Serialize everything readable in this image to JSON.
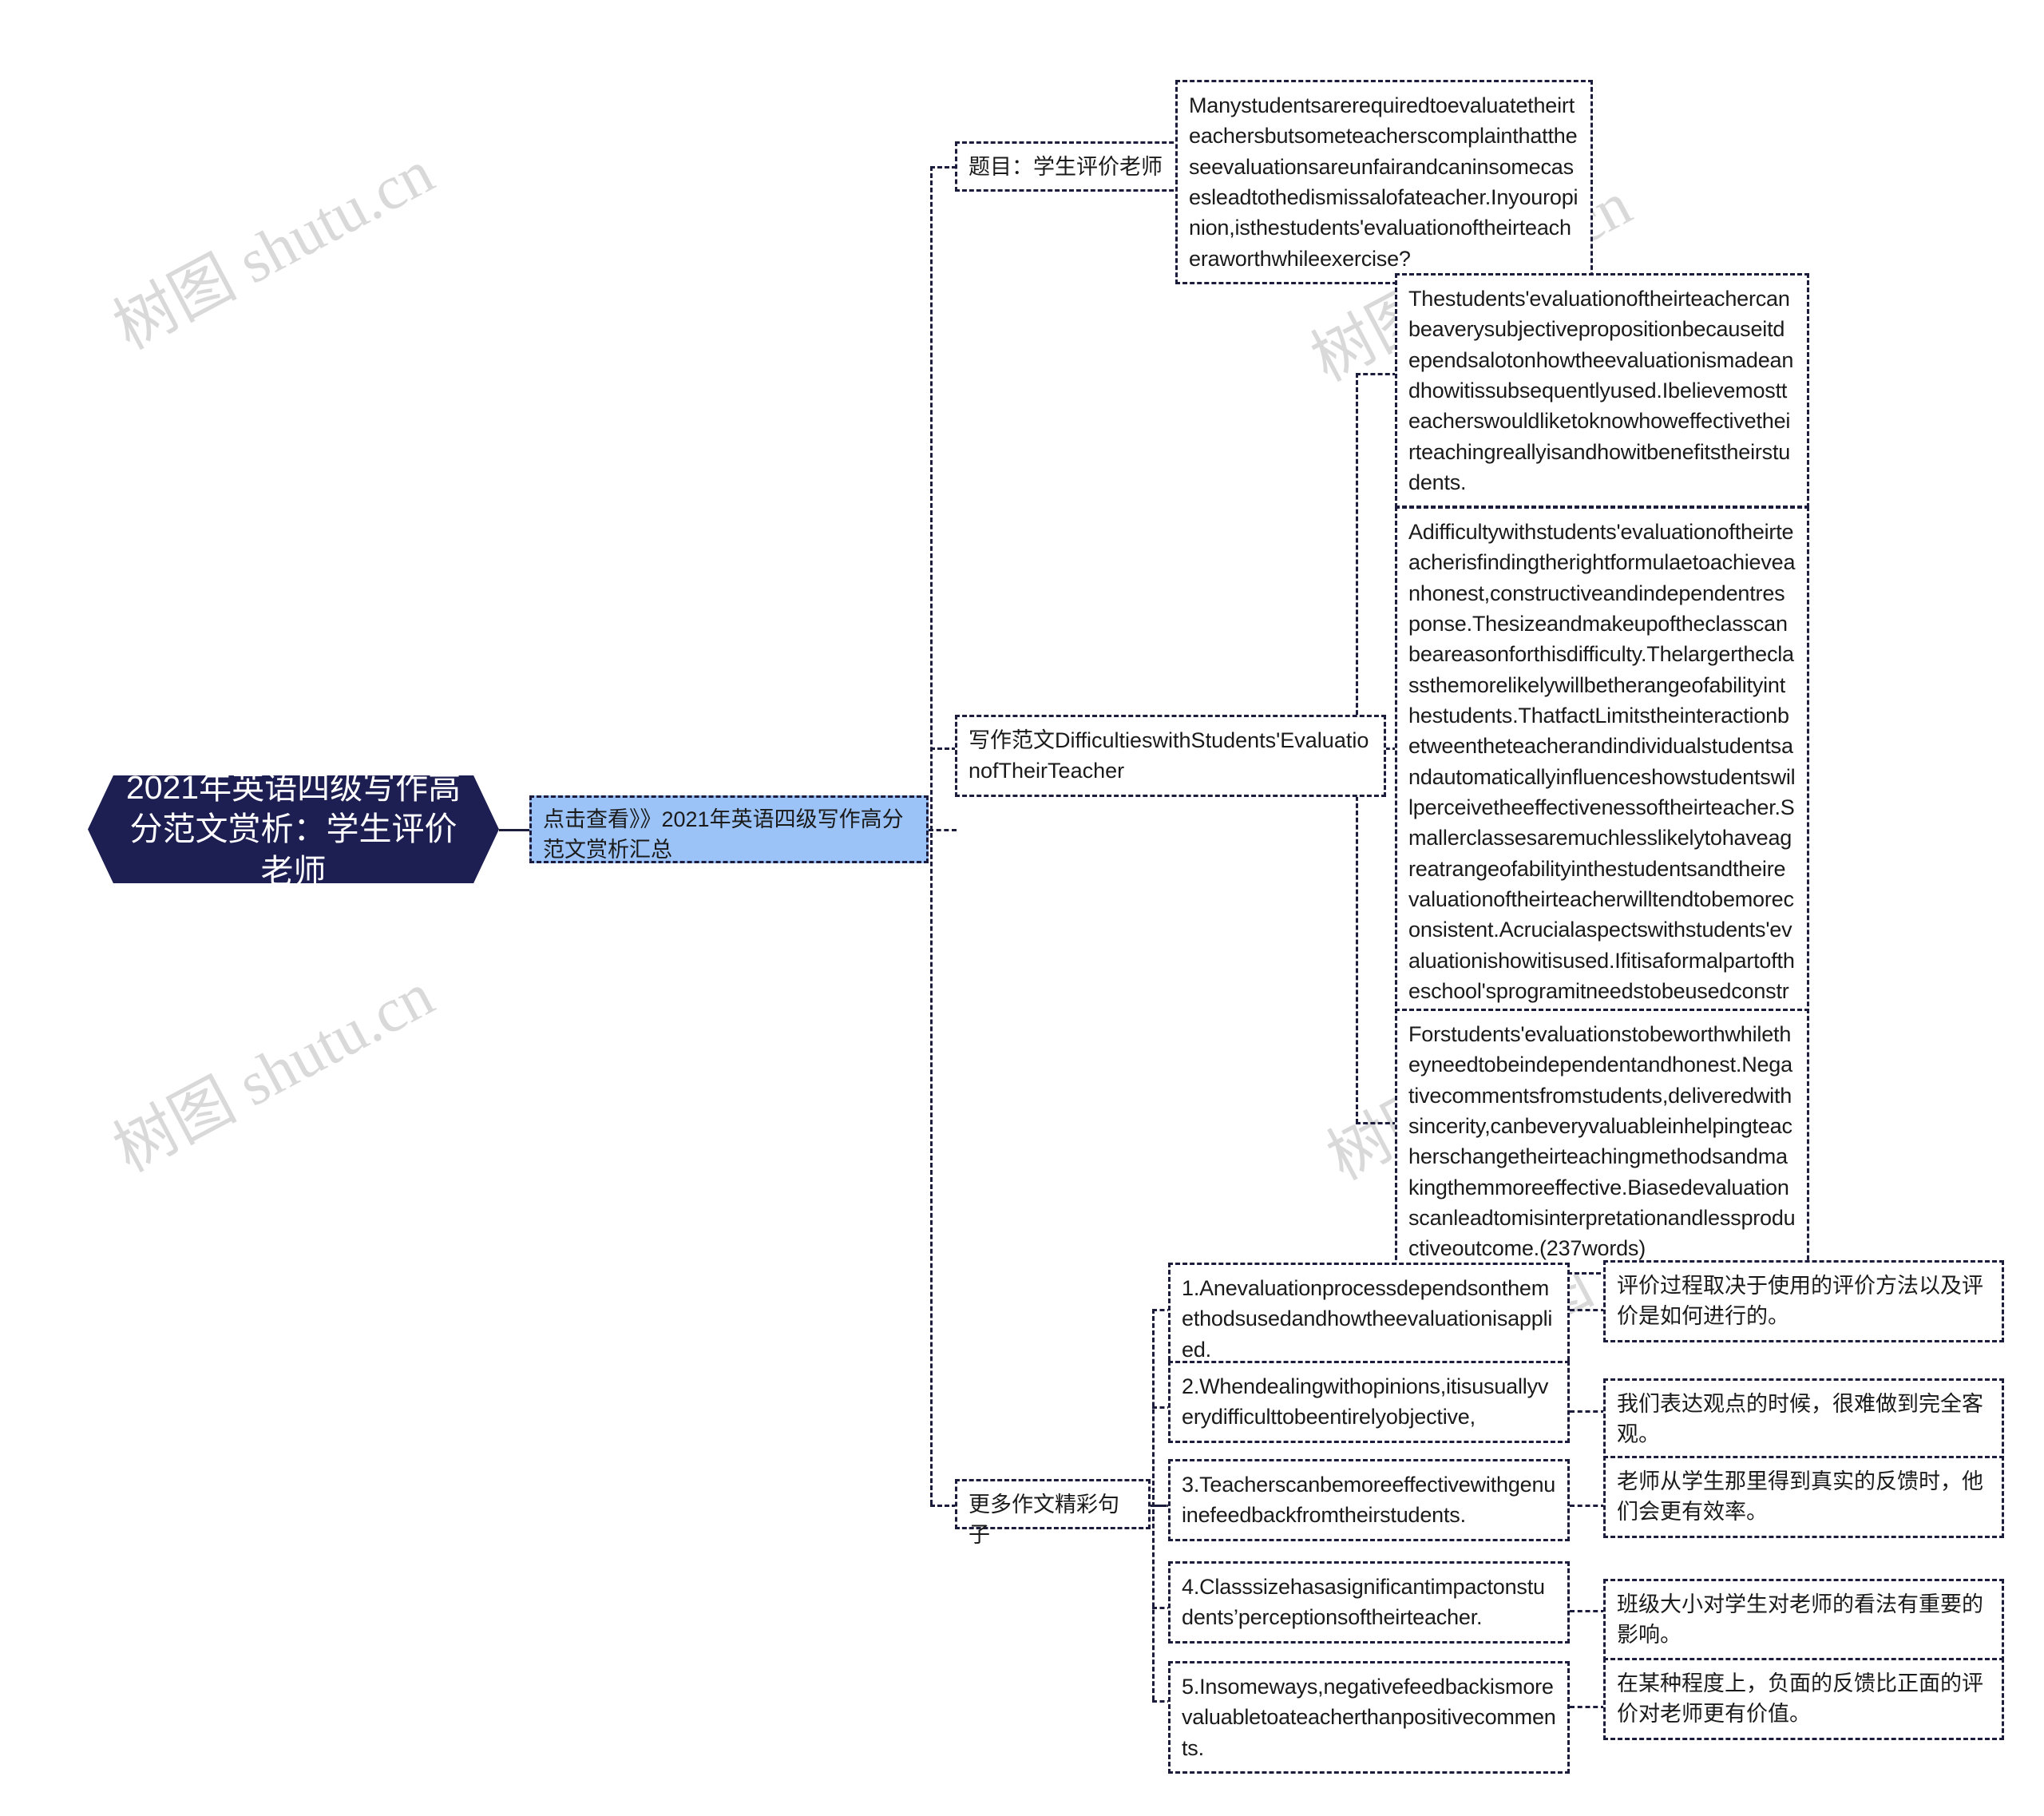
{
  "watermarks": [
    "树图 shutu.cn",
    "树图 shutu.cn",
    "树图 shutu.cn",
    "树图 shutu.cn",
    "树图 shutu.cn"
  ],
  "colors": {
    "root_bg": "#1d1e52",
    "root_text": "#ffffff",
    "link_bg": "#9cc3f7",
    "border": "#1c1c3c",
    "node_bg": "#ffffff",
    "text": "#1a1a1a",
    "watermark": "#d9d9d9"
  },
  "root": {
    "title": "2021年英语四级写作高分范文赏析：学生评价老师"
  },
  "link_node": {
    "label": "点击查看》》2021年英语四级写作高分范文赏析汇总"
  },
  "branches": {
    "topic": {
      "label": "题目：学生评价老师",
      "content": "Manystudentsarerequiredtoevaluatetheirteachersbutsometeacherscomplainthattheseevaluationsareunfairandcaninsomecasesleadtothedismissalofateacher.Inyouropinion,isthestudents'evaluationoftheirteacheraworthwhileexercise?"
    },
    "essay": {
      "label": "写作范文DifficultieswithStudents'EvaluationofTheirTeacher",
      "paragraphs": [
        "Thestudents'evaluationoftheirteachercanbeaverysubjectivepropositionbecauseitdependsalotonhowtheevaluationismadeandhowitissubsequentlyused.Ibelievemostteacherswouldliketoknowhoweffectivetheirteachingreallyisandhowitbenefitstheirstudents.",
        "Adifficultywithstudents'evaluationoftheirteacherisfindingtherightformulaetoachieveanhonest,constructiveandindependentresponse.Thesizeandmakeupoftheclasscanbeareasonforthisdifficulty.Thelargertheclassthemorelikelywillbetherangeofabilityinthestudents.ThatfactLimitstheinteractionbetweentheteacherandindividualstudentsandautomaticallyinfluenceshowstudentswillperceivetheeffectivenessoftheirteacher.Smallerclassesaremuchlesslikelytohaveagreatrangeofabilityinthestudentsandtheirevaluationoftheirteacherwilltendtobemoreconsistent.Acrucialaspectswithstudents'evaluationishowitisused.Ifitisaformalpartoftheschool'sprogramitneedstobeusedconstructivelyinliaisonwiththeteachersforthebenefitofbothteachersandstudents.",
        "Forstudents'evaluationstobeworthwhiletheyneedtobeindependentandhonest.Negativecommentsfromstudents,deliveredwithsincerity,canbeveryvaluableinhelpingteacherschangetheirteachingmethodsandmakingthemmoreeffective.Biasedevaluationscanleadtomisinterpretationandlessproductiveoutcome.(237words)"
      ]
    },
    "more_sentences": {
      "label": "更多作文精彩句子",
      "items": [
        {
          "en": "1.Anevaluationprocessdependsonthemethodsusedandhowtheevaluationisapplied.",
          "cn": "评价过程取决于使用的评价方法以及评价是如何进行的。"
        },
        {
          "en": "2.Whendealingwithopinions,itisusuallyverydifficulttobeentirelyobjective,",
          "cn": "我们表达观点的时候，很难做到完全客观。"
        },
        {
          "en": "3.Teacherscanbemoreeffectivewithgenuinefeedbackfromtheirstudents.",
          "cn": "老师从学生那里得到真实的反馈时，他们会更有效率。"
        },
        {
          "en": "4.Classsizehasasignificantimpactonstudents’perceptionsoftheirteacher.",
          "cn": "班级大小对学生对老师的看法有重要的影响。"
        },
        {
          "en": "5.Insomeways,negativefeedbackismorevaluabletoateacherthanpositivecomments.",
          "cn": "在某种程度上，负面的反馈比正面的评价对老师更有价值。"
        }
      ]
    }
  }
}
